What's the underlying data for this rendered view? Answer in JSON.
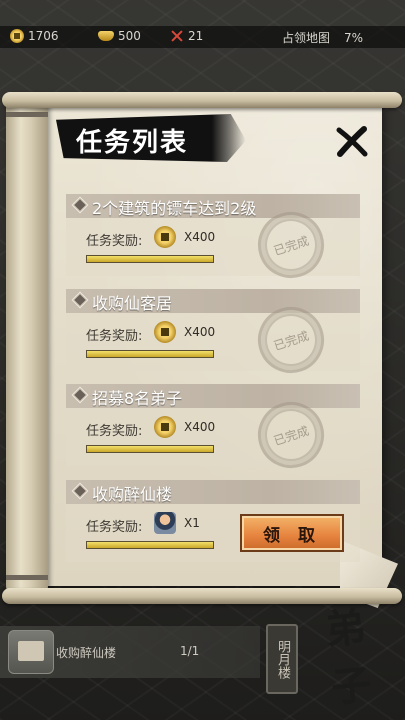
{
  "hud": {
    "copper": "1706",
    "gold": "500",
    "power": "21",
    "territory_label": "占领地图",
    "territory_pct": "7%"
  },
  "dialog": {
    "title": "任务列表"
  },
  "tasks": [
    {
      "name": "2个建筑的镖车达到2级",
      "reward_label": "任务奖励:",
      "reward_icon": "copper-coin-icon",
      "reward_qty": "X400",
      "progress": 1.0,
      "status": "completed",
      "stamp_text": "已完成"
    },
    {
      "name": "收购仙客居",
      "reward_label": "任务奖励:",
      "reward_icon": "copper-coin-icon",
      "reward_qty": "X400",
      "progress": 1.0,
      "status": "completed",
      "stamp_text": "已完成"
    },
    {
      "name": "招募8名弟子",
      "reward_label": "任务奖励:",
      "reward_icon": "copper-coin-icon",
      "reward_qty": "X400",
      "progress": 1.0,
      "status": "completed",
      "stamp_text": "已完成"
    },
    {
      "name": "收购醉仙楼",
      "reward_label": "任务奖励:",
      "reward_icon": "disciple-avatar-icon",
      "reward_qty": "X1",
      "progress": 1.0,
      "status": "claimable",
      "claim_label": "领 取"
    }
  ],
  "bottom": {
    "quest_text": "收购醉仙楼",
    "quest_count": "1/1",
    "sign_text": "明月楼",
    "brush_text": "弟子"
  }
}
